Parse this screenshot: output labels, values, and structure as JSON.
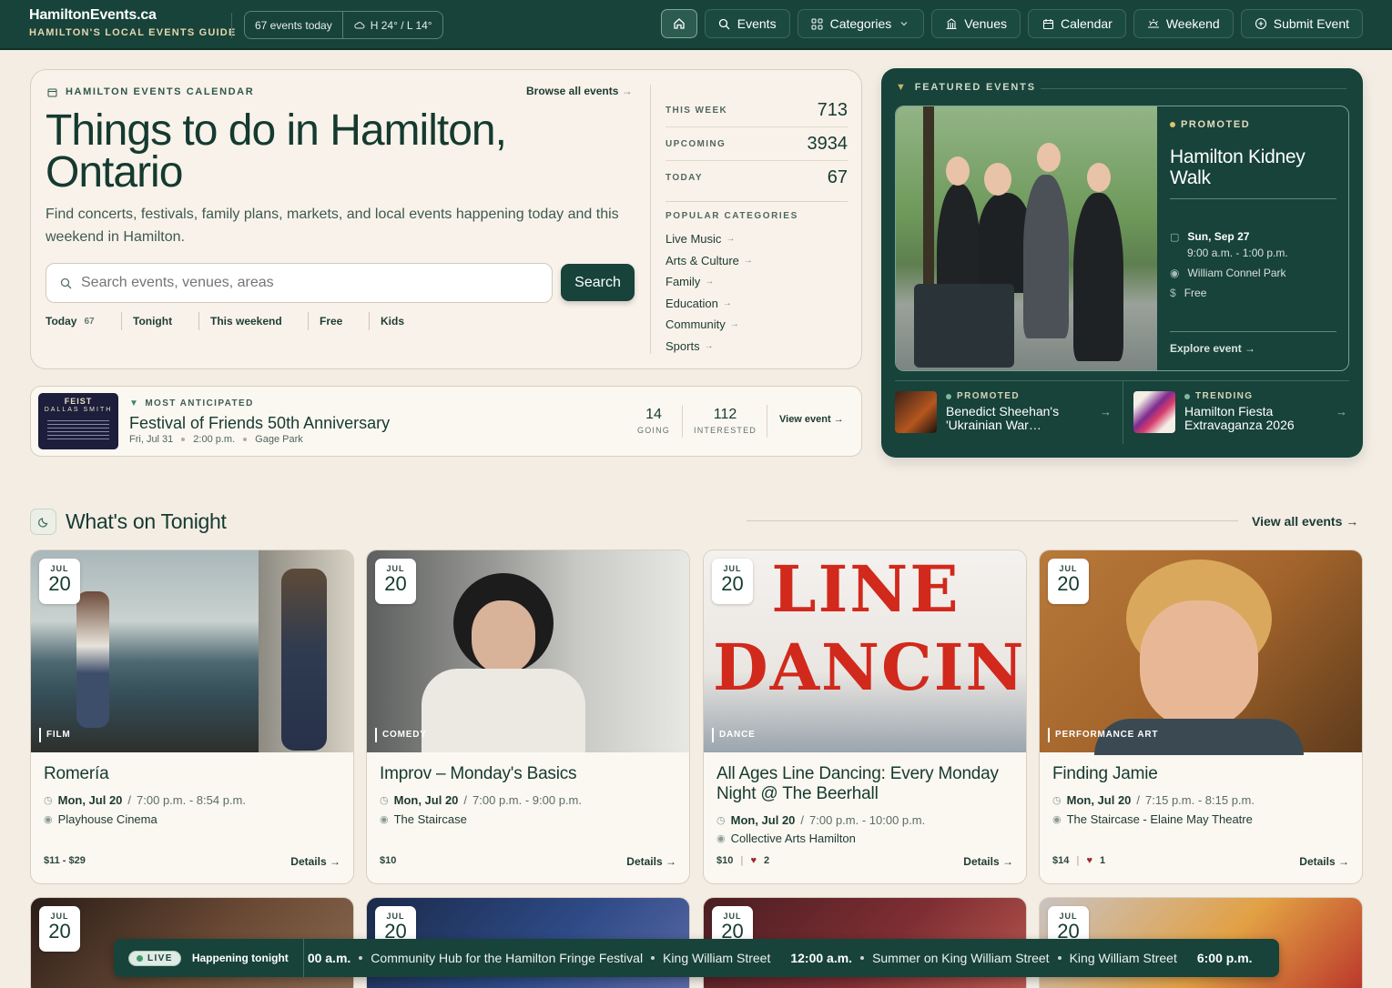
{
  "brand": {
    "name": "HamiltonEvents.ca",
    "tagline": "HAMILTON'S LOCAL EVENTS GUIDE"
  },
  "topbar": {
    "events_today": "67 events today",
    "weather": "H 24° / L 14°"
  },
  "nav": {
    "events": "Events",
    "categories": "Categories",
    "venues": "Venues",
    "calendar": "Calendar",
    "weekend": "Weekend",
    "submit": "Submit Event"
  },
  "hero": {
    "eyebrow": "HAMILTON EVENTS CALENDAR",
    "browse_all": "Browse all events",
    "title": "Things to do in Hamilton, Ontario",
    "lead": "Find concerts, festivals, family plans, markets, and local events happening today and this weekend in Hamilton.",
    "search_placeholder": "Search events, venues, areas",
    "search_button": "Search",
    "quick_filters": [
      "Today",
      "Tonight",
      "This weekend",
      "Free",
      "Kids"
    ],
    "today_count": "67"
  },
  "stats": [
    {
      "label": "THIS WEEK",
      "value": "713"
    },
    {
      "label": "UPCOMING",
      "value": "3934"
    },
    {
      "label": "TODAY",
      "value": "67"
    }
  ],
  "popular_categories": {
    "heading": "POPULAR CATEGORIES",
    "items": [
      "Live Music",
      "Arts & Culture",
      "Family",
      "Education",
      "Community",
      "Sports"
    ]
  },
  "anticipated": {
    "label": "MOST ANTICIPATED",
    "title": "Festival of Friends 50th Anniversary",
    "date": "Fri, Jul 31",
    "time": "2:00 p.m.",
    "venue": "Gage Park",
    "going": "14",
    "going_label": "GOING",
    "interested": "112",
    "interested_label": "INTERESTED",
    "view": "View event",
    "poster_title": "FEIST",
    "poster_sub": "DALLAS SMITH"
  },
  "featured": {
    "heading": "FEATURED EVENTS",
    "main": {
      "badge": "PROMOTED",
      "title": "Hamilton Kidney Walk",
      "date": "Sun, Sep 27",
      "time": "9:00 a.m. - 1:00 p.m.",
      "venue": "William Connel Park",
      "price": "Free",
      "explore": "Explore event"
    },
    "minis": [
      {
        "badge": "PROMOTED",
        "title": "Benedict Sheehan's 'Ukrainian War…"
      },
      {
        "badge": "TRENDING",
        "title": "Hamilton Fiesta Extravaganza 2026"
      }
    ]
  },
  "tonight": {
    "heading": "What's on Tonight",
    "view_all": "View all events",
    "cards": [
      {
        "month": "JUL",
        "day": "20",
        "category": "FILM",
        "title": "Romería",
        "date": "Mon, Jul 20",
        "time": "7:00 p.m. - 8:54 p.m.",
        "venue": "Playhouse Cinema",
        "price": "$11 - $29",
        "likes": "",
        "details": "Details"
      },
      {
        "month": "JUL",
        "day": "20",
        "category": "COMEDY",
        "title": "Improv – Monday's Basics",
        "date": "Mon, Jul 20",
        "time": "7:00 p.m. - 9:00 p.m.",
        "venue": "The Staircase",
        "price": "$10",
        "likes": "",
        "details": "Details"
      },
      {
        "month": "JUL",
        "day": "20",
        "category": "DANCE",
        "title": "All Ages Line Dancing: Every Monday Night @ The Beerhall",
        "date": "Mon, Jul 20",
        "time": "7:00 p.m. - 10:00 p.m.",
        "venue": "Collective Arts Hamilton",
        "price": "$10",
        "likes": "2",
        "details": "Details",
        "image_text": "LINE DANCING"
      },
      {
        "month": "JUL",
        "day": "20",
        "category": "PERFORMANCE ART",
        "title": "Finding Jamie",
        "date": "Mon, Jul 20",
        "time": "7:15 p.m. - 8:15 p.m.",
        "venue": "The Staircase - Elaine May Theatre",
        "price": "$14",
        "likes": "1",
        "details": "Details"
      }
    ],
    "second_row": [
      {
        "month": "JUL",
        "day": "20"
      },
      {
        "month": "JUL",
        "day": "20"
      },
      {
        "month": "JUL",
        "day": "20"
      },
      {
        "month": "JUL",
        "day": "20"
      }
    ]
  },
  "ticker": {
    "live": "LIVE",
    "heading": "Happening tonight",
    "items": [
      {
        "time": "00 a.m.",
        "title": "Community Hub for the Hamilton Fringe Festival",
        "venue": "King William Street"
      },
      {
        "time": "12:00 a.m.",
        "title": "Summer on King William Street",
        "venue": "King William Street"
      },
      {
        "time": "6:00 p.m.",
        "title": "",
        "venue": ""
      }
    ]
  },
  "colors": {
    "primary": "#17433a",
    "background": "#f3ede4",
    "card": "#fbf7f1",
    "accent_gold": "#e0c36a"
  }
}
